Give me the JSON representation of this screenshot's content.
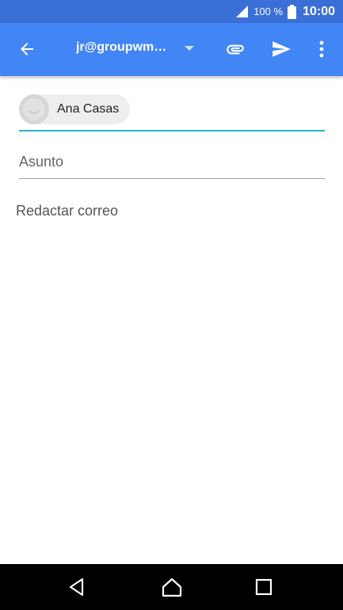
{
  "status_bar": {
    "battery_percent": "100 %",
    "time": "10:00"
  },
  "app_bar": {
    "account": "jr@groupwm…",
    "icons": [
      "arrow-back-icon",
      "dropdown-arrow-icon",
      "paperclip-icon",
      "send-icon",
      "more-vert-icon"
    ]
  },
  "compose": {
    "recipient_name": "Ana Casas",
    "subject_placeholder": "Asunto",
    "body_placeholder": "Redactar correo"
  },
  "colors": {
    "status_bar": "#3b6fd8",
    "app_bar": "#4285f4",
    "to_underline": "#26b4c4"
  },
  "nav_bar": {
    "icons": [
      "nav-back-icon",
      "nav-home-icon",
      "nav-recents-icon"
    ]
  }
}
